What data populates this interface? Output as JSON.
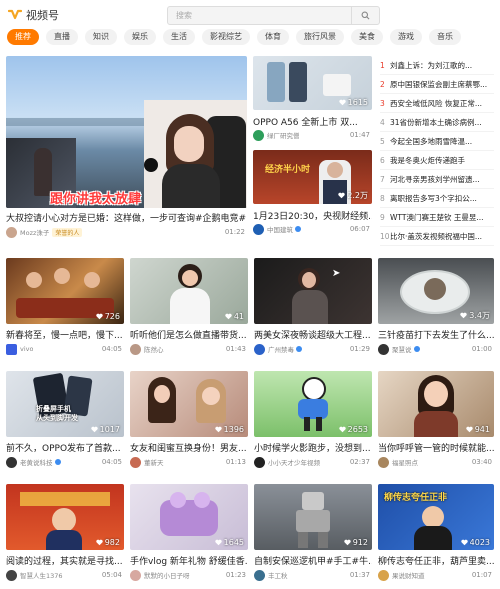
{
  "brand": {
    "name": "视频号",
    "accent": "#ff7a00"
  },
  "search": {
    "placeholder": "搜索"
  },
  "tabs": [
    "推荐",
    "直播",
    "知识",
    "娱乐",
    "生活",
    "影视综艺",
    "体育",
    "旅行风景",
    "美食",
    "游戏",
    "音乐"
  ],
  "featured": {
    "title": "大叔控请小心对方是已婚：这样做，一步可查询#企鹅电竞#...",
    "author": "Mozz洙子",
    "badge": "荣誉的人",
    "duration": "01:22",
    "caption": "跟你讲我太放肆"
  },
  "hot_list": [
    {
      "num": "1",
      "text": "刘鑫上诉：为刘江歌的..."
    },
    {
      "num": "2",
      "text": "原中国银保监会副主席蔡鄂..."
    },
    {
      "num": "3",
      "text": "西安全域低风险 恢复正常..."
    },
    {
      "num": "4",
      "text": "31省份新增本土确诊病例..."
    },
    {
      "num": "5",
      "text": "今起全国多地雨雪降温..."
    },
    {
      "num": "6",
      "text": "我是冬奥火炬传递跑手"
    },
    {
      "num": "7",
      "text": "河北寻亲男孩刘学州留遗..."
    },
    {
      "num": "8",
      "text": "离职报告多写3个字扣公..."
    },
    {
      "num": "9",
      "text": "WTT澳门赛王楚钦 王曼昱..."
    },
    {
      "num": "10",
      "text": "比尔·盖茨发视频祝福中国..."
    }
  ],
  "side_cards": [
    {
      "title": "OPPO A56 全新上市 双...",
      "author": "绿厂研究僧",
      "likes": "1615",
      "duration": "01:47"
    },
    {
      "title": "1月23日20:30，央视财经频...",
      "author": "中国建筑",
      "likes": "2.2万",
      "duration": "06:07"
    }
  ],
  "grid": [
    {
      "title": "新春将至，慢一点吧，慢下...",
      "author": "vivo",
      "likes": "726",
      "duration": "04:05"
    },
    {
      "title": "听听他们是怎么做直播带货...",
      "author": "陈然心",
      "likes": "41",
      "duration": "01:43"
    },
    {
      "title": "两美女深夜畅谈超级大工程...",
      "author": "广州禁毒",
      "likes": "",
      "duration": "01:29"
    },
    {
      "title": "三针疫苗打下去发生了什么...",
      "author": "聚慧说",
      "likes": "3.4万",
      "duration": "01:00"
    },
    {
      "title": "前不久，OPPO发布了首款...",
      "author": "老黄说科技",
      "likes": "1017",
      "duration": "04:05"
    },
    {
      "title": "女友和闺蜜互换身份！男友...",
      "author": "董新天",
      "likes": "1396",
      "duration": "01:13"
    },
    {
      "title": "小时候学火影跑步，没想到...",
      "author": "小小天才少年视频",
      "likes": "2653",
      "duration": "02:37"
    },
    {
      "title": "当你呼呼管一管的时候就能...",
      "author": "福星照点",
      "likes": "941",
      "duration": "03:40"
    },
    {
      "title": "阅读的过程，其实就是寻找...",
      "author": "智慧人生1376",
      "likes": "982",
      "duration": "05:04"
    },
    {
      "title": "手作vlog 新年礼物 舒缓佳香...",
      "author": "默默的小日子呀",
      "likes": "1645",
      "duration": "01:23"
    },
    {
      "title": "自制安保巡逻机甲#手工#牛...",
      "author": "丰工秋",
      "likes": "912",
      "duration": "01:37"
    },
    {
      "title": "柳传志夸任正非，葫芦里卖...",
      "author": "果说财知道",
      "likes": "4023",
      "duration": "01:07"
    }
  ],
  "thumb_texts": {
    "grid5": "折叠屏手机\n从头到脚开发",
    "grid12": "柳传志夸任正非",
    "side2": "经济半小时"
  }
}
